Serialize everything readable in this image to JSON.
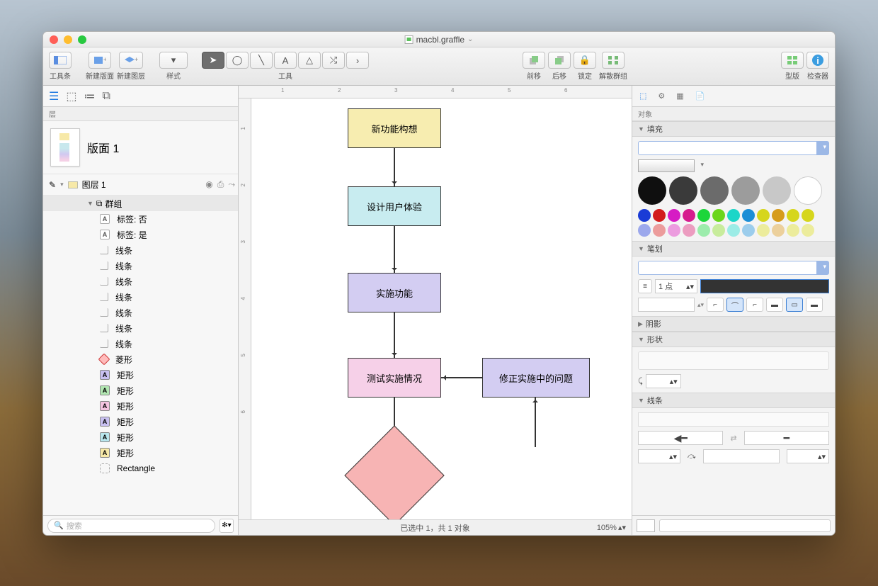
{
  "window": {
    "title": "macbl.graffle"
  },
  "toolbar": {
    "toolbar_label": "工具条",
    "new_canvas": "新建版面",
    "new_layer": "新建图层",
    "style": "样式",
    "tools": "工具",
    "forward": "前移",
    "backward": "后移",
    "lock": "锁定",
    "ungroup": "解散群组",
    "stencils": "型版",
    "inspector": "检查器"
  },
  "sidebar": {
    "header": "层",
    "canvas": "版面 1",
    "layer": "图层 1",
    "group": "群组",
    "items": [
      {
        "icon": "text",
        "label": "标签: 否"
      },
      {
        "icon": "text",
        "label": "标签: 是"
      },
      {
        "icon": "line",
        "label": "线条"
      },
      {
        "icon": "line",
        "label": "线条"
      },
      {
        "icon": "line",
        "label": "线条"
      },
      {
        "icon": "line",
        "label": "线条"
      },
      {
        "icon": "line",
        "label": "线条"
      },
      {
        "icon": "line",
        "label": "线条"
      },
      {
        "icon": "line",
        "label": "线条"
      },
      {
        "icon": "diamond",
        "label": "菱形"
      },
      {
        "icon": "rect",
        "color": "#c8c0f0",
        "label": "矩形"
      },
      {
        "icon": "rect",
        "color": "#b2e6b2",
        "label": "矩形"
      },
      {
        "icon": "rect",
        "color": "#f4c4e0",
        "label": "矩形"
      },
      {
        "icon": "rect",
        "color": "#c8c0f0",
        "label": "矩形"
      },
      {
        "icon": "rect",
        "color": "#b8e6ed",
        "label": "矩形"
      },
      {
        "icon": "rect",
        "color": "#f7e9a8",
        "label": "矩形"
      },
      {
        "icon": "rectangle-outline",
        "label": "Rectangle"
      }
    ],
    "search_placeholder": "搜索"
  },
  "canvas": {
    "boxes": {
      "b1": "新功能构想",
      "b2": "设计用户体验",
      "b3": "实施功能",
      "b4": "测试实施情况",
      "b5": "修正实施中的问题"
    },
    "status": "已选中 1，共 1 对象",
    "zoom": "105%"
  },
  "inspector": {
    "header": "对象",
    "fill": "填充",
    "stroke": "笔划",
    "stroke_width": "1 点",
    "shadow": "阴影",
    "shape": "形状",
    "line": "线条",
    "big_swatches": [
      "#0f0f0f",
      "#3a3a3a",
      "#6b6b6b",
      "#9c9c9c",
      "#c8c8c8",
      "#ffffff"
    ],
    "small_swatches": [
      "#1a3bd6",
      "#d21c1c",
      "#d61cc4",
      "#d61c8e",
      "#1cd63a",
      "#6bd61c",
      "#1cd6c8",
      "#1c8ed6",
      "#d6d61c",
      "#d69c1c",
      "#d6d61c",
      "#d6d61c",
      "#9ca8ec",
      "#ec9c9c",
      "#ec9cdf",
      "#ec9cc0",
      "#9cecac",
      "#c8ec9c",
      "#9cece6",
      "#9ccdec",
      "#ecec9c",
      "#ecd09c",
      "#ecec9c",
      "#ecec9c"
    ]
  }
}
